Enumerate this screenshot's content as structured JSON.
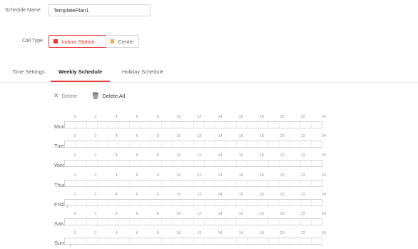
{
  "schedule_name": {
    "label": "Schedule Name",
    "value": "TemplatePlan1"
  },
  "call_type": {
    "label": "Call Type",
    "options": [
      {
        "label": "Indoor Station",
        "color": "#e53935",
        "selected": true
      },
      {
        "label": "Center",
        "color": "#f5b04a",
        "selected": false
      }
    ]
  },
  "tabs": [
    {
      "label": "Time Settings",
      "active": false
    },
    {
      "label": "Weekly Schedule",
      "active": true
    },
    {
      "label": "Holiday Schedule",
      "active": false
    }
  ],
  "toolbar": {
    "delete_label": "Delete",
    "delete_all_label": "Delete All"
  },
  "timeline": {
    "ticks": [
      "0",
      "2",
      "4",
      "6",
      "8",
      "10",
      "12",
      "14",
      "16",
      "18",
      "20",
      "22",
      "24"
    ],
    "days": [
      "Mond...",
      "Tuesd...",
      "Wedn...",
      "Thurs...",
      "Friday",
      "Satur...",
      "Sunday"
    ]
  },
  "colors": {
    "accent": "#e53935",
    "center": "#f5b04a"
  }
}
